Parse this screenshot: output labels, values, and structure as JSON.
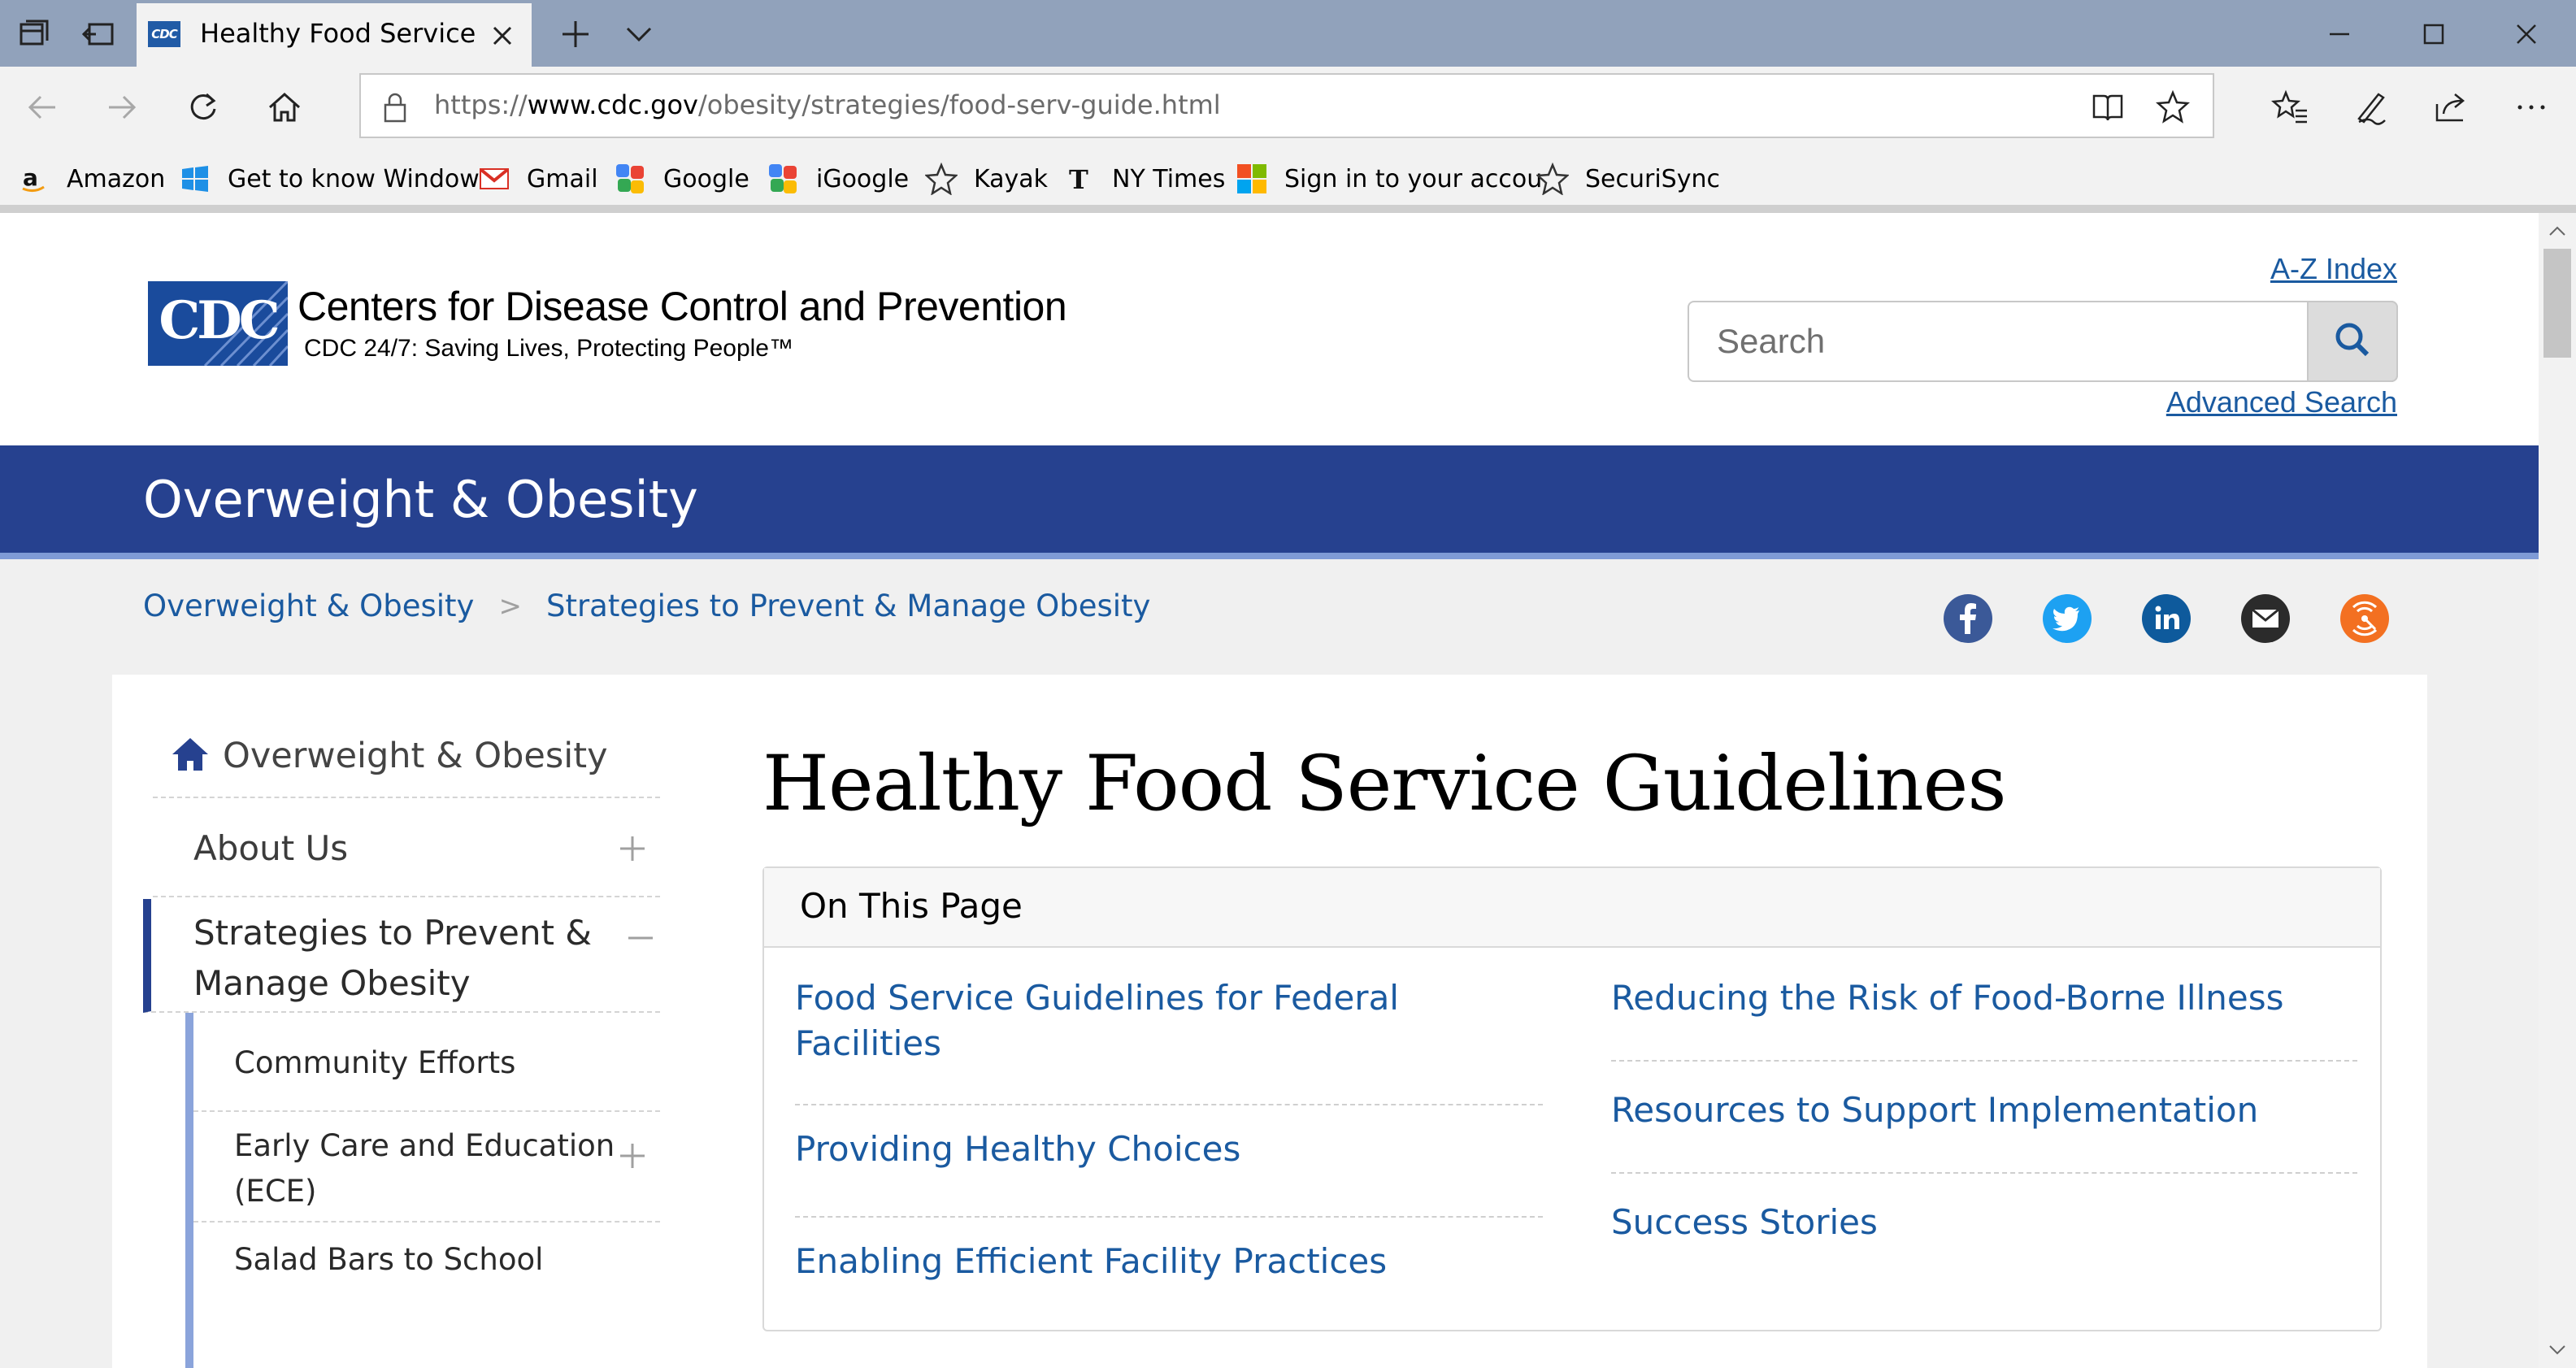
{
  "browser": {
    "tab": {
      "title": "Healthy Food Service Gu",
      "favicon_text": "CDC"
    },
    "address": {
      "url_prefix": "https://",
      "url_domain": "www.cdc.gov",
      "url_path": "/obesity/strategies/food-serv-guide.html"
    },
    "favorites": [
      {
        "label": "Amazon",
        "icon": "amazon-icon"
      },
      {
        "label": "Get to know Window",
        "icon": "windows-icon"
      },
      {
        "label": "Gmail",
        "icon": "gmail-icon"
      },
      {
        "label": "Google",
        "icon": "google-icon"
      },
      {
        "label": "iGoogle",
        "icon": "igoogle-icon"
      },
      {
        "label": "Kayak",
        "icon": "star-outline-icon"
      },
      {
        "label": "NY Times",
        "icon": "nytimes-icon"
      },
      {
        "label": "Sign in to your accou",
        "icon": "microsoft-icon"
      },
      {
        "label": "SecuriSync",
        "icon": "star-outline-icon"
      }
    ]
  },
  "header": {
    "logo_text": "CDC",
    "org_name": "Centers for Disease Control and Prevention",
    "tagline": "CDC 24/7: Saving Lives, Protecting People™",
    "az_index": "A-Z Index",
    "search_placeholder": "Search",
    "advanced_search": "Advanced Search"
  },
  "banner": {
    "title": "Overweight & Obesity"
  },
  "breadcrumb": {
    "items": [
      "Overweight & Obesity",
      "Strategies to Prevent & Manage Obesity"
    ],
    "separator": ">"
  },
  "social": [
    "facebook-icon",
    "twitter-icon",
    "linkedin-icon",
    "email-icon",
    "syndicate-icon"
  ],
  "leftnav": {
    "home": "Overweight & Obesity",
    "items": [
      {
        "label": "About Us",
        "toggle": "+"
      },
      {
        "label_line1": "Strategies to Prevent &",
        "label_line2": "Manage Obesity",
        "toggle": "−"
      }
    ],
    "subitems": [
      {
        "label": "Community Efforts"
      },
      {
        "label_line1": "Early Care and Education",
        "label_line2": "(ECE)",
        "toggle": "+"
      },
      {
        "label": "Salad Bars to School"
      }
    ]
  },
  "main": {
    "title": "Healthy Food Service Guidelines",
    "on_this_page": {
      "heading": "On This Page",
      "left_links": [
        {
          "line1": "Food Service Guidelines for Federal",
          "line2": "Facilities"
        },
        {
          "line1": "Providing Healthy Choices"
        },
        {
          "line1": "Enabling Efficient Facility Practices"
        }
      ],
      "right_links": [
        "Reducing the Risk of Food-Borne Illness",
        "Resources to Support Implementation",
        "Success Stories"
      ]
    }
  },
  "colors": {
    "banner": "#26418f",
    "link": "#1a5aa0",
    "tabbar": "#91a2bb",
    "cdc_logo": "#1a4b9c"
  }
}
